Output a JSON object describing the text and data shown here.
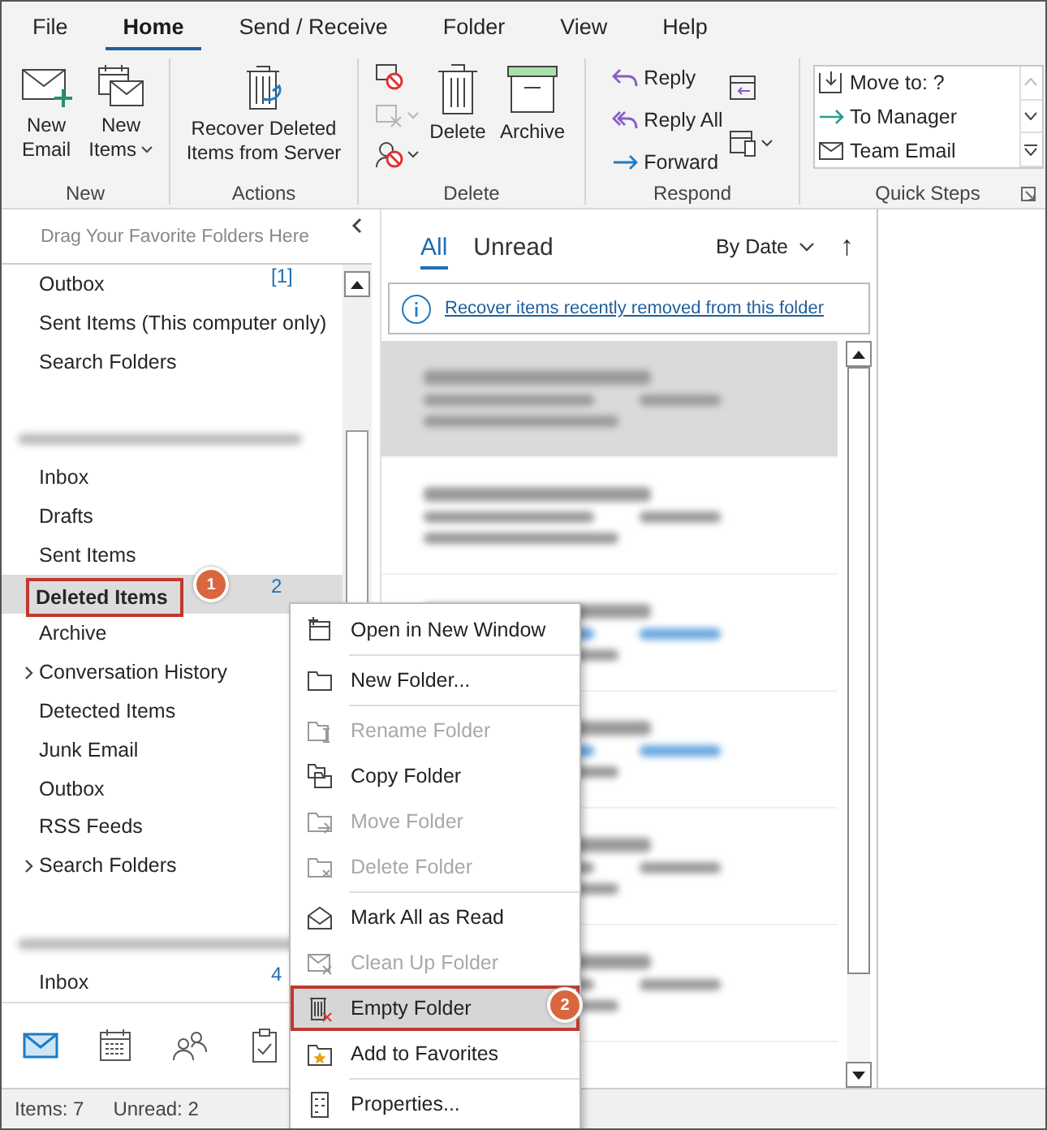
{
  "menu_tabs": [
    {
      "label": "File",
      "selected": false
    },
    {
      "label": "Home",
      "selected": true
    },
    {
      "label": "Send / Receive",
      "selected": false
    },
    {
      "label": "Folder",
      "selected": false
    },
    {
      "label": "View",
      "selected": false
    },
    {
      "label": "Help",
      "selected": false
    }
  ],
  "ribbon": {
    "new": {
      "label": "New",
      "new_email": "New Email",
      "new_items": "New Items"
    },
    "actions": {
      "label": "Actions",
      "recover": "Recover Deleted Items from Server"
    },
    "delete": {
      "label": "Delete",
      "tools": [
        {
          "disabled": false
        },
        {
          "disabled": true
        },
        {
          "disabled": false
        }
      ],
      "delete": "Delete",
      "archive": "Archive"
    },
    "respond": {
      "label": "Respond",
      "reply": "Reply",
      "reply_all": "Reply All",
      "forward": "Forward"
    },
    "quick_steps": {
      "label": "Quick Steps",
      "items": [
        "Move to: ?",
        "To Manager",
        "Team Email"
      ]
    }
  },
  "folder_pane": {
    "favorites_hint": "Drag Your Favorite Folders Here",
    "folders": [
      {
        "kind": "folder",
        "label": "Outbox",
        "count": "[1]",
        "selected": false,
        "expandable": false
      },
      {
        "kind": "folder",
        "label": "Sent Items (This computer only)",
        "selected": false,
        "expandable": false
      },
      {
        "kind": "folder",
        "label": "Search Folders",
        "selected": false,
        "expandable": false
      },
      {
        "kind": "account"
      },
      {
        "kind": "folder",
        "label": "Inbox",
        "selected": false,
        "expandable": false
      },
      {
        "kind": "folder",
        "label": "Drafts",
        "selected": false,
        "expandable": false
      },
      {
        "kind": "folder",
        "label": "Sent Items",
        "selected": false,
        "expandable": false
      },
      {
        "kind": "folder",
        "label": "Deleted Items",
        "count": "2",
        "selected": true,
        "expandable": false,
        "callout": "1"
      },
      {
        "kind": "folder",
        "label": "Archive",
        "selected": false,
        "expandable": false
      },
      {
        "kind": "folder",
        "label": "Conversation History",
        "selected": false,
        "expandable": true
      },
      {
        "kind": "folder",
        "label": "Detected Items",
        "selected": false,
        "expandable": false
      },
      {
        "kind": "folder",
        "label": "Junk Email",
        "selected": false,
        "expandable": false
      },
      {
        "kind": "folder",
        "label": "Outbox",
        "selected": false,
        "expandable": false
      },
      {
        "kind": "folder",
        "label": "RSS Feeds",
        "selected": false,
        "expandable": false
      },
      {
        "kind": "folder",
        "label": "Search Folders",
        "selected": false,
        "expandable": true
      },
      {
        "kind": "account"
      },
      {
        "kind": "folder",
        "label": "Inbox",
        "count": "4",
        "selected": false,
        "expandable": false
      }
    ],
    "nav": [
      {
        "selected": true
      },
      {
        "selected": false
      },
      {
        "selected": false
      },
      {
        "selected": false
      }
    ]
  },
  "message_list": {
    "filters": [
      {
        "label": "All",
        "selected": true
      },
      {
        "label": "Unread",
        "selected": false
      }
    ],
    "sort": "By Date",
    "sort_direction": "↑",
    "info_link": "Recover items recently removed from this folder",
    "messages": [
      {
        "selected": true,
        "unread": false
      },
      {
        "selected": false,
        "unread": false
      },
      {
        "selected": false,
        "unread": true
      },
      {
        "selected": false,
        "unread": true
      },
      {
        "selected": false,
        "unread": false
      },
      {
        "selected": false,
        "unread": false
      }
    ]
  },
  "context_menu": [
    {
      "label": "Open in New Window",
      "disabled": false,
      "selected": false,
      "separator_after": true
    },
    {
      "label": "New Folder...",
      "disabled": false,
      "selected": false,
      "separator_after": true
    },
    {
      "label": "Rename Folder",
      "disabled": true,
      "selected": false,
      "separator_after": false
    },
    {
      "label": "Copy Folder",
      "disabled": false,
      "selected": false,
      "separator_after": false
    },
    {
      "label": "Move Folder",
      "disabled": true,
      "selected": false,
      "separator_after": false
    },
    {
      "label": "Delete Folder",
      "disabled": true,
      "selected": false,
      "separator_after": true
    },
    {
      "label": "Mark All as Read",
      "disabled": false,
      "selected": false,
      "separator_after": false
    },
    {
      "label": "Clean Up Folder",
      "disabled": true,
      "selected": false,
      "separator_after": false
    },
    {
      "label": "Empty Folder",
      "disabled": false,
      "selected": true,
      "separator_after": false,
      "callout": "2"
    },
    {
      "label": "Add to Favorites",
      "disabled": false,
      "selected": false,
      "separator_after": true
    },
    {
      "label": "Properties...",
      "disabled": false,
      "selected": false,
      "separator_after": false
    }
  ],
  "status_bar": {
    "items": "Items: 7",
    "unread": "Unread: 2"
  }
}
